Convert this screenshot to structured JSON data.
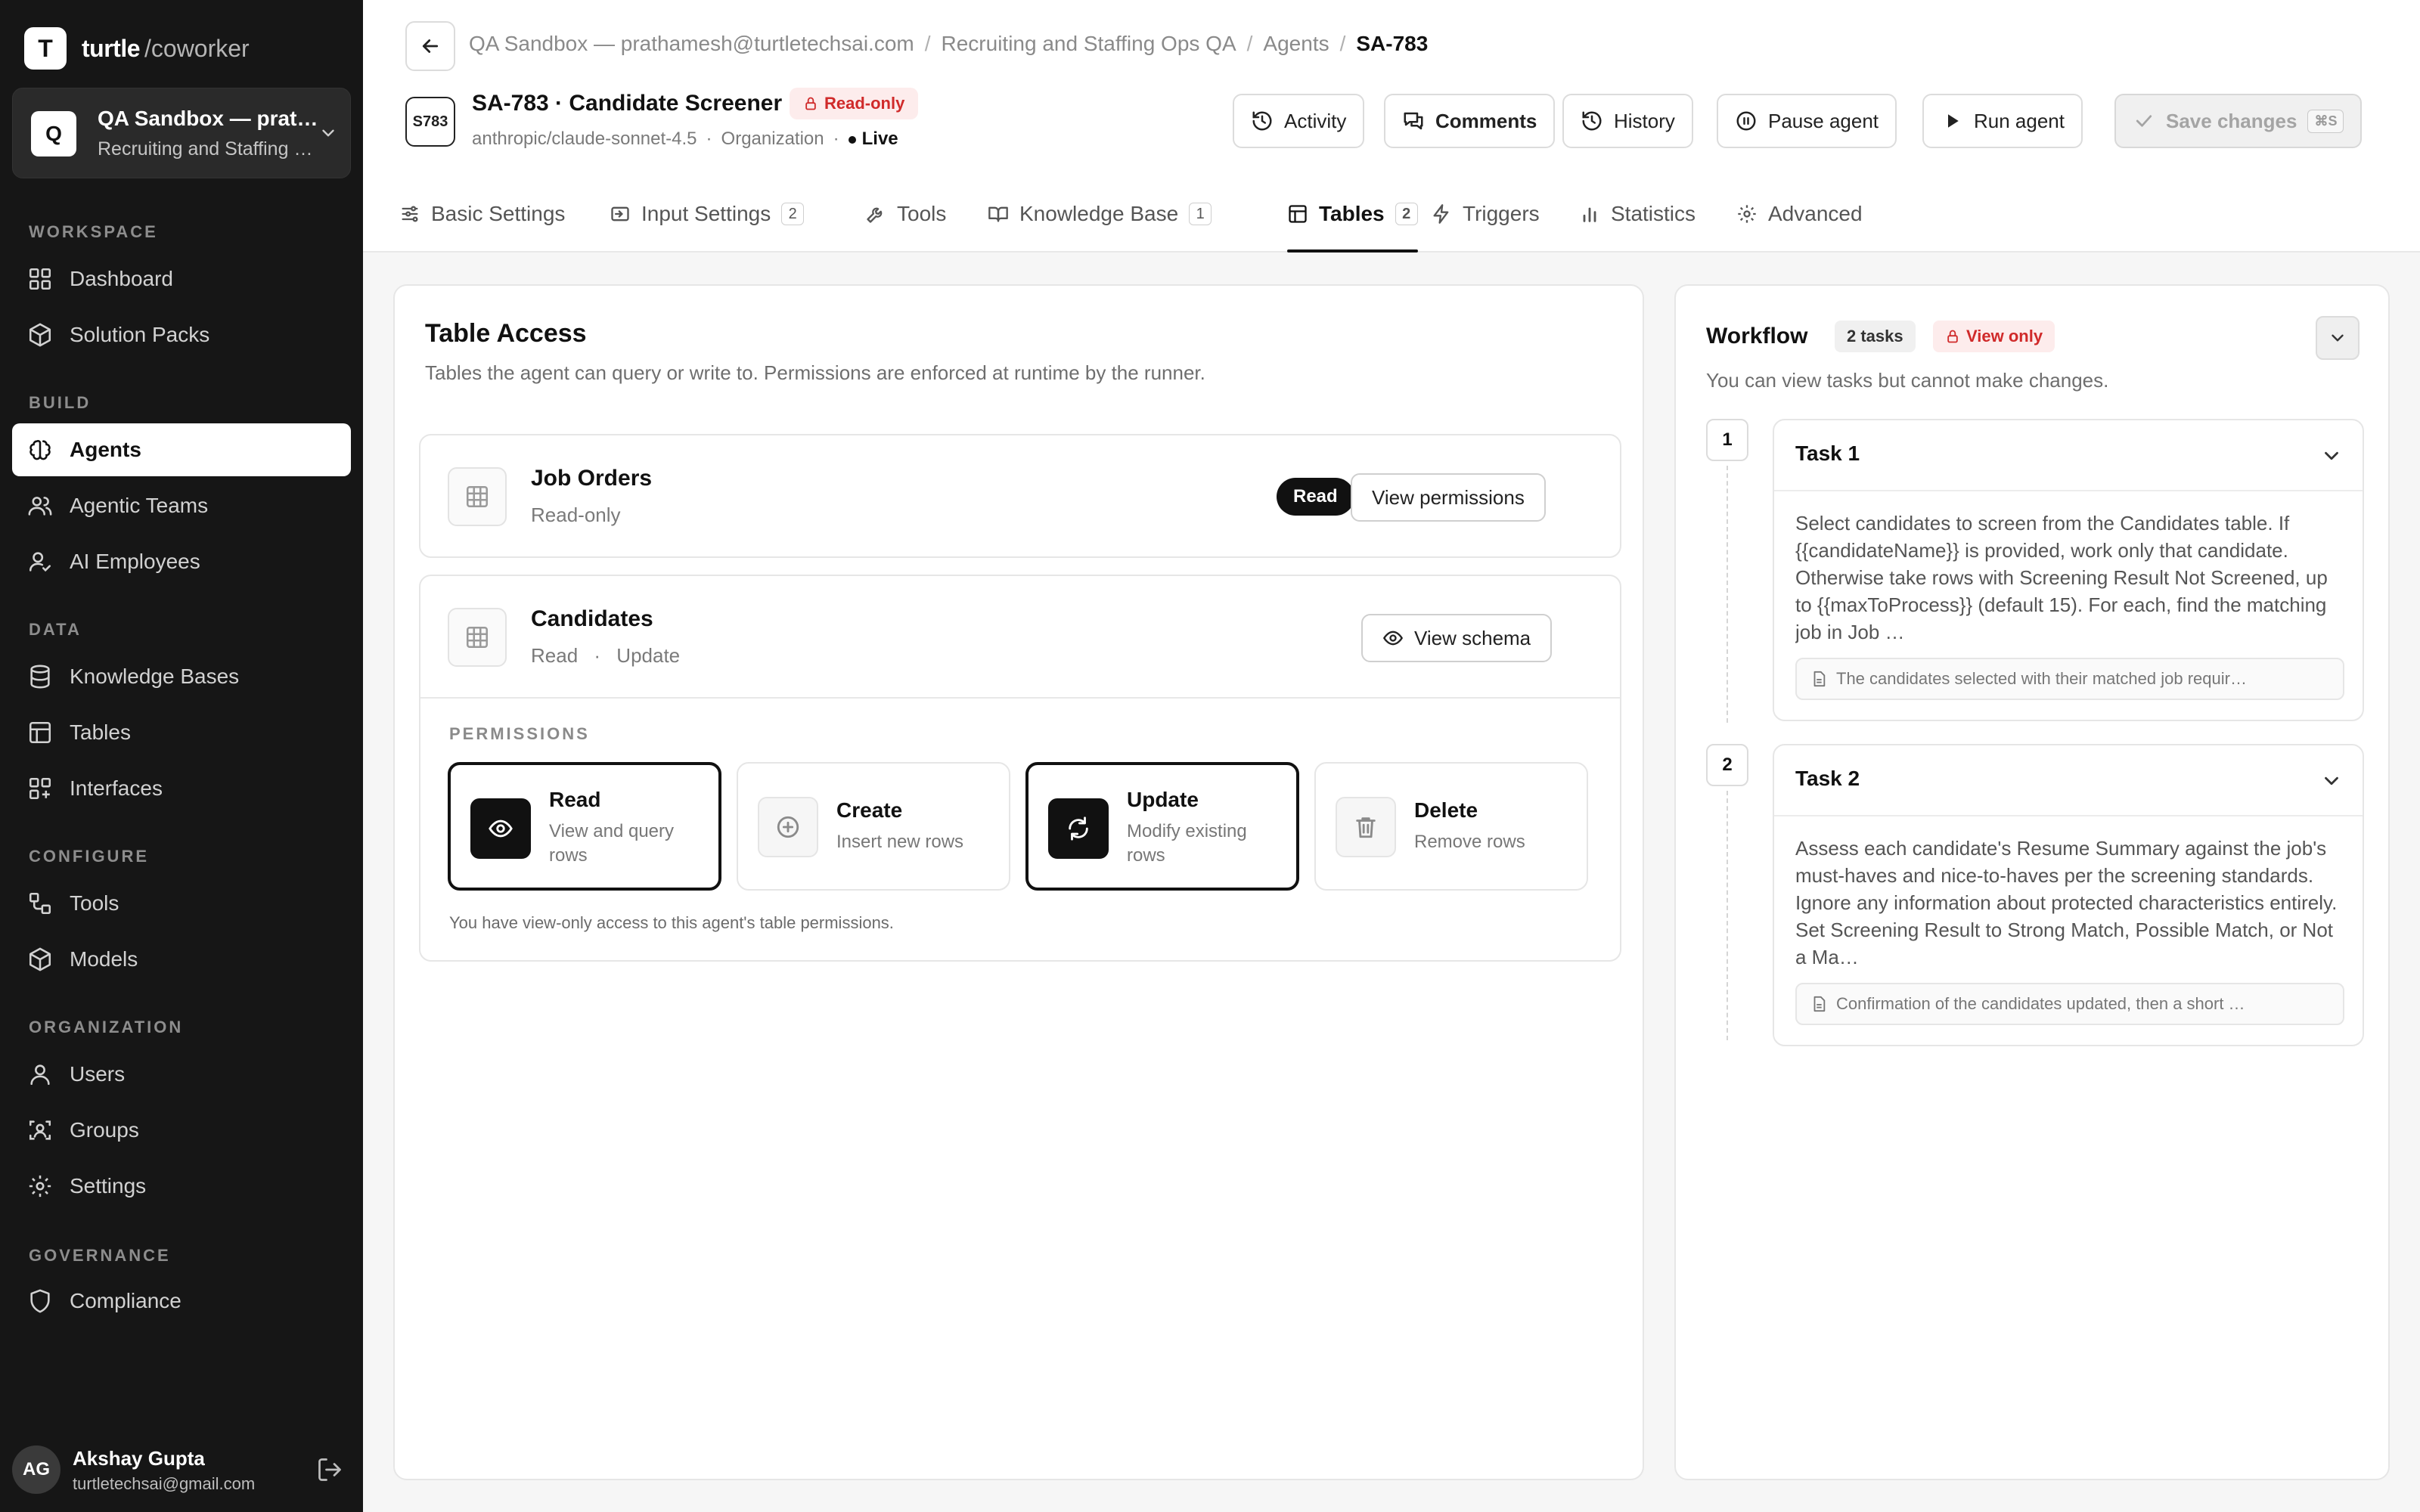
{
  "brand": {
    "logo": "T",
    "name": "turtle",
    "suffix": "/coworker"
  },
  "workspace": {
    "avatar": "Q",
    "title": "QA Sandbox — prathamesh@turtletechsai.com",
    "subtitle": "Recruiting and Staffing Ops QA"
  },
  "nav": {
    "sections": [
      "WORKSPACE",
      "BUILD",
      "DATA",
      "CONFIGURE",
      "ORGANIZATION",
      "GOVERNANCE"
    ],
    "items": [
      {
        "label": "Dashboard",
        "icon": "dashboard-icon"
      },
      {
        "label": "Solution Packs",
        "icon": "package-icon"
      },
      {
        "label": "Agents",
        "icon": "brain-icon"
      },
      {
        "label": "Agentic Teams",
        "icon": "team-icon"
      },
      {
        "label": "AI Employees",
        "icon": "user-check-icon"
      },
      {
        "label": "Knowledge Bases",
        "icon": "database-icon"
      },
      {
        "label": "Tables",
        "icon": "table-icon"
      },
      {
        "label": "Interfaces",
        "icon": "grid-icon"
      },
      {
        "label": "Tools",
        "icon": "workflow-icon"
      },
      {
        "label": "Models",
        "icon": "cube-icon"
      },
      {
        "label": "Users",
        "icon": "user-icon"
      },
      {
        "label": "Groups",
        "icon": "group-icon"
      },
      {
        "label": "Settings",
        "icon": "gear-icon"
      },
      {
        "label": "Compliance",
        "icon": "shield-icon"
      }
    ]
  },
  "user": {
    "initials": "AG",
    "name": "Akshay Gupta",
    "email": "turtletechsai@gmail.com"
  },
  "breadcrumb": [
    "QA Sandbox — prathamesh@turtletechsai.com",
    "Recruiting and Staffing Ops QA",
    "Agents",
    "SA-783"
  ],
  "agent": {
    "badge": "S783",
    "title": "SA-783 · Candidate Screener",
    "readonly": "Read-only",
    "model": "anthropic/claude-sonnet-4.5",
    "scope": "Organization",
    "status": "Live"
  },
  "header_buttons": {
    "activity": "Activity",
    "comments": "Comments",
    "history": "History",
    "pause": "Pause agent",
    "run": "Run agent",
    "save": "Save changes",
    "save_kbd": "⌘S"
  },
  "tabs": [
    {
      "label": "Basic Settings",
      "count": ""
    },
    {
      "label": "Input Settings",
      "count": "2"
    },
    {
      "label": "Tools",
      "count": ""
    },
    {
      "label": "Knowledge Base",
      "count": "1"
    },
    {
      "label": "Tables",
      "count": "2"
    },
    {
      "label": "Triggers",
      "count": ""
    },
    {
      "label": "Statistics",
      "count": ""
    },
    {
      "label": "Advanced",
      "count": ""
    }
  ],
  "table_access": {
    "title": "Table Access",
    "description": "Tables the agent can query or write to. Permissions are enforced at runtime by the runner.",
    "tables": [
      {
        "name": "Job Orders",
        "sub": "Read-only",
        "badge": "Read",
        "button": "View permissions"
      },
      {
        "name": "Candidates",
        "sub_a": "Read",
        "sub_sep": "·",
        "sub_b": "Update",
        "button": "View schema"
      }
    ],
    "permissions_label": "PERMISSIONS",
    "permissions": [
      {
        "name": "Read",
        "desc": "View and query rows",
        "enabled": true
      },
      {
        "name": "Create",
        "desc": "Insert new rows",
        "enabled": false
      },
      {
        "name": "Update",
        "desc": "Modify existing rows",
        "enabled": true
      },
      {
        "name": "Delete",
        "desc": "Remove rows",
        "enabled": false
      }
    ],
    "note": "You have view-only access to this agent's table permissions."
  },
  "workflow": {
    "title": "Workflow",
    "count": "2 tasks",
    "view_only": "View only",
    "description": "You can view tasks but cannot make changes.",
    "tasks": [
      {
        "num": "1",
        "name": "Task 1",
        "text": "Select candidates to screen from the Candidates table. If {{candidateName}} is provided, work only that candidate. Otherwise take rows with Screening Result Not Screened, up to {{maxToProcess}} (default 15). For each, find the matching job in Job …",
        "output": "The candidates selected with their matched job requir…"
      },
      {
        "num": "2",
        "name": "Task 2",
        "text": "Assess each candidate's Resume Summary against the job's must-haves and nice-to-haves per the screening standards. Ignore any information about protected characteristics entirely. Set Screening Result to Strong Match, Possible Match, or Not a Ma…",
        "output": "Confirmation of the candidates updated, then a short …"
      }
    ]
  }
}
